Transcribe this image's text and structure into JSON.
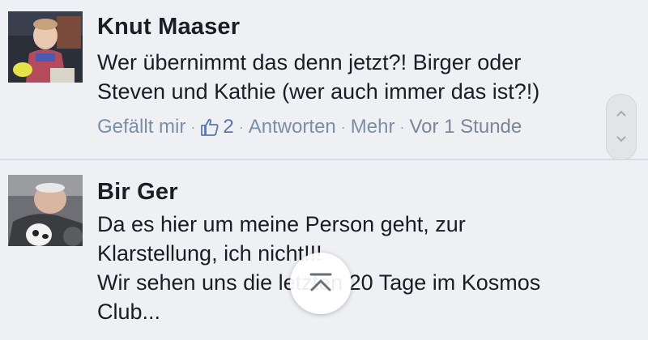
{
  "comments": [
    {
      "author": "Knut Maaser",
      "lines": [
        "Wer übernimmt das denn jetzt?! Birger oder",
        "Steven und Kathie (wer auch immer das ist?!)"
      ],
      "actions": {
        "like": "Gefällt mir",
        "like_count": "2",
        "reply": "Antworten",
        "more": "Mehr",
        "time": "Vor 1 Stunde"
      }
    },
    {
      "author": "Bir Ger",
      "lines": [
        "Da es hier um meine Person geht, zur",
        "Klarstellung, ich nicht!!!",
        "Wir sehen uns die letzten 20 Tage im Kosmos",
        "Club..."
      ]
    }
  ],
  "separator": "·",
  "icons": {
    "like": "thumbs-up-icon",
    "scroll_up": "chevron-up-icon",
    "scroll_down": "chevron-down-icon",
    "scroll_to_top": "scroll-to-top-icon"
  },
  "colors": {
    "background": "#eef0f4",
    "author": "#1a1d21",
    "meta": "#7b8697",
    "link": "#5b76a8"
  }
}
